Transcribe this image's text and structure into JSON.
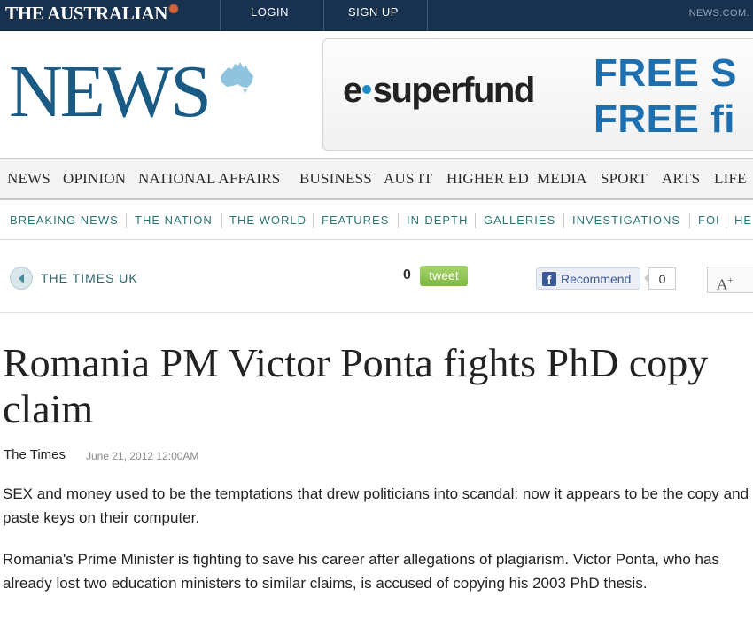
{
  "topbar": {
    "brand": "THE AUSTRALIAN",
    "login": "LOGIN",
    "signup": "SIGN UP",
    "network": "NEWS.COM."
  },
  "masthead": {
    "logo": "NEWS"
  },
  "ad": {
    "logo_prefix": "e",
    "logo_rest": "superfund",
    "line1_visible": "FREE S",
    "line1_fade": "",
    "line2_visible": "FREE fi",
    "line2_fade": ""
  },
  "primary_nav": [
    "NEWS",
    "OPINION",
    "NATIONAL AFFAIRS",
    "BUSINESS",
    "AUS IT",
    "HIGHER ED",
    "MEDIA",
    "SPORT",
    "ARTS",
    "LIFE"
  ],
  "secondary_nav": [
    "BREAKING NEWS",
    "THE NATION",
    "THE WORLD",
    "FEATURES",
    "IN-DEPTH",
    "GALLERIES",
    "INVESTIGATIONS",
    "FOI",
    "HE"
  ],
  "tools": {
    "section": "THE TIMES UK",
    "tweet_count": "0",
    "tweet_label": "tweet",
    "recommend_label": "Recommend",
    "recommend_count": "0",
    "font_size_label": "A",
    "font_size_sup": "+"
  },
  "article": {
    "headline": "Romania PM Victor Ponta fights PhD copy claim",
    "source": "The Times",
    "date": "June 21, 2012 12:00AM",
    "paragraphs": [
      "SEX and money used to be the temptations that drew politicians into scandal: now it appears to be the copy and paste keys on their computer.",
      "Romania's Prime Minister is fighting to save his career after allegations of plagiarism. Victor Ponta, who has already lost two education ministers to similar claims, is accused of copying his 2003 PhD thesis."
    ]
  },
  "colors": {
    "topbar_bg": "#17314f",
    "logo_blue": "#1a5b86",
    "brand_accent": "#d8633a",
    "secondary_nav_teal": "#2c7575",
    "tweet_green": "#8bc34a",
    "facebook_blue": "#3b5998"
  },
  "icons": {
    "back": "back-arrow-circle-icon",
    "map": "australia-map-icon",
    "facebook": "facebook-icon"
  }
}
